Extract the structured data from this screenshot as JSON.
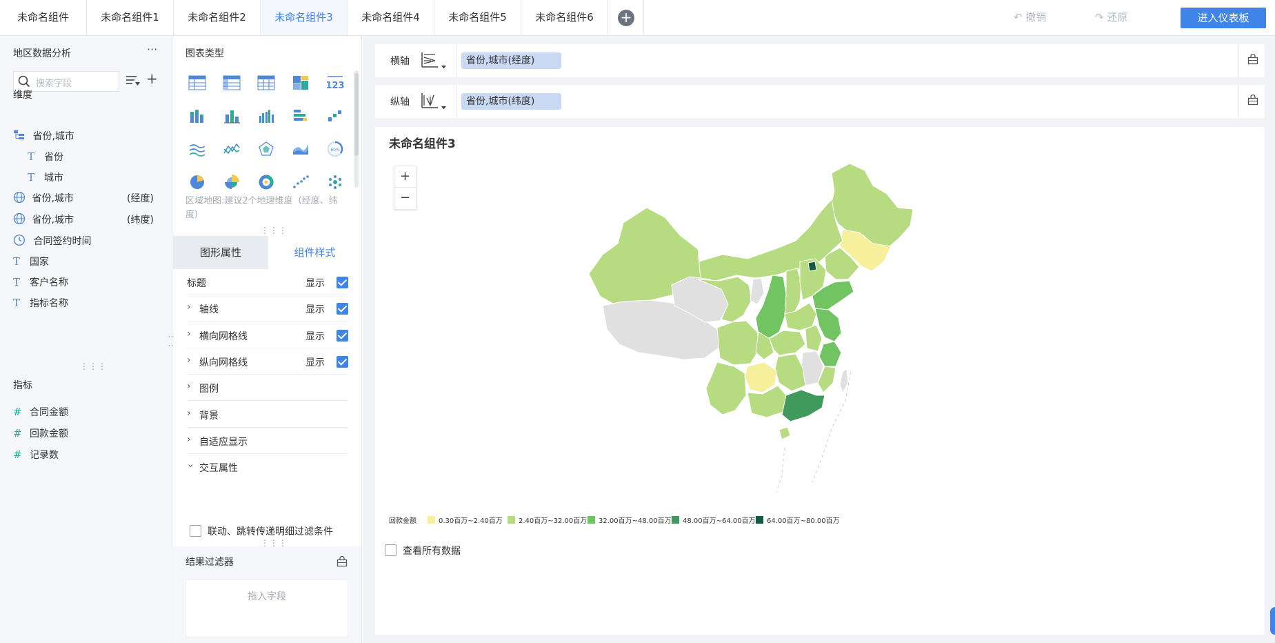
{
  "tabs": [
    {
      "label": "未命名组件"
    },
    {
      "label": "未命名组件1"
    },
    {
      "label": "未命名组件2"
    },
    {
      "label": "未命名组件3",
      "active": true
    },
    {
      "label": "未命名组件4"
    },
    {
      "label": "未命名组件5"
    },
    {
      "label": "未命名组件6"
    }
  ],
  "toolbar": {
    "undo_label": "撤销",
    "redo_label": "还原",
    "enter_dashboard_label": "进入仪表板"
  },
  "fields_panel": {
    "title": "地区数据分析",
    "more": "···",
    "search_placeholder": "搜索字段",
    "dimension_label": "维度",
    "dimensions": [
      {
        "label": "省份,城市",
        "icon": "tree-icon"
      },
      {
        "label": "省份",
        "icon": "text-icon"
      },
      {
        "label": "城市",
        "icon": "text-icon"
      },
      {
        "label": "省份,城市",
        "icon": "globe-icon",
        "suffix": "(经度)"
      },
      {
        "label": "省份,城市",
        "icon": "globe-icon",
        "suffix": "(纬度)"
      },
      {
        "label": "合同签约时间",
        "icon": "clock-icon"
      },
      {
        "label": "国家",
        "icon": "text-icon"
      },
      {
        "label": "客户名称",
        "icon": "text-icon"
      },
      {
        "label": "指标名称",
        "icon": "text-icon"
      }
    ],
    "measure_label": "指标",
    "measures": [
      {
        "label": "合同金额",
        "icon": "hash-icon"
      },
      {
        "label": "回款金额",
        "icon": "hash-icon"
      },
      {
        "label": "记录数",
        "icon": "hash-icon"
      }
    ]
  },
  "chart_types": {
    "title": "图表类型",
    "hint": "区域地图:建议2个地理维度（经度、纬度）"
  },
  "property_tabs": {
    "shape_label": "图形属性",
    "style_label": "组件样式"
  },
  "style_props": [
    {
      "label": "标题",
      "show": "显示",
      "checked": true
    },
    {
      "label": "轴线",
      "show": "显示",
      "checked": true
    },
    {
      "label": "横向网格线",
      "show": "显示",
      "checked": true
    },
    {
      "label": "纵向网格线",
      "show": "显示",
      "checked": true
    },
    {
      "label": "图例"
    },
    {
      "label": "背景"
    },
    {
      "label": "自适应显示"
    },
    {
      "label": "交互属性"
    }
  ],
  "interaction_option": "联动、跳转传递明细过滤条件",
  "result_filter": {
    "title": "结果过滤器",
    "drop_hint": "拖入字段"
  },
  "axes": {
    "x_label": "横轴",
    "x_field": "省份,城市(经度)",
    "y_label": "纵轴",
    "y_field": "省份,城市(纬度)"
  },
  "chart": {
    "title": "未命名组件3",
    "zoom_in": "+",
    "zoom_out": "−",
    "legend_title": "回款金额",
    "legend": [
      {
        "label": "0.30百万~2.40百万",
        "color": "#f6ef9b"
      },
      {
        "label": "2.40百万~32.00百万",
        "color": "#b7db80"
      },
      {
        "label": "32.00百万~48.00百万",
        "color": "#72c462"
      },
      {
        "label": "48.00百万~64.00百万",
        "color": "#3f9a5b"
      },
      {
        "label": "64.00百万~80.00百万",
        "color": "#125c45"
      }
    ],
    "view_all": "查看所有数据"
  },
  "colors": {
    "accent": "#3f84e8",
    "no_data": "#e0e0e0"
  }
}
